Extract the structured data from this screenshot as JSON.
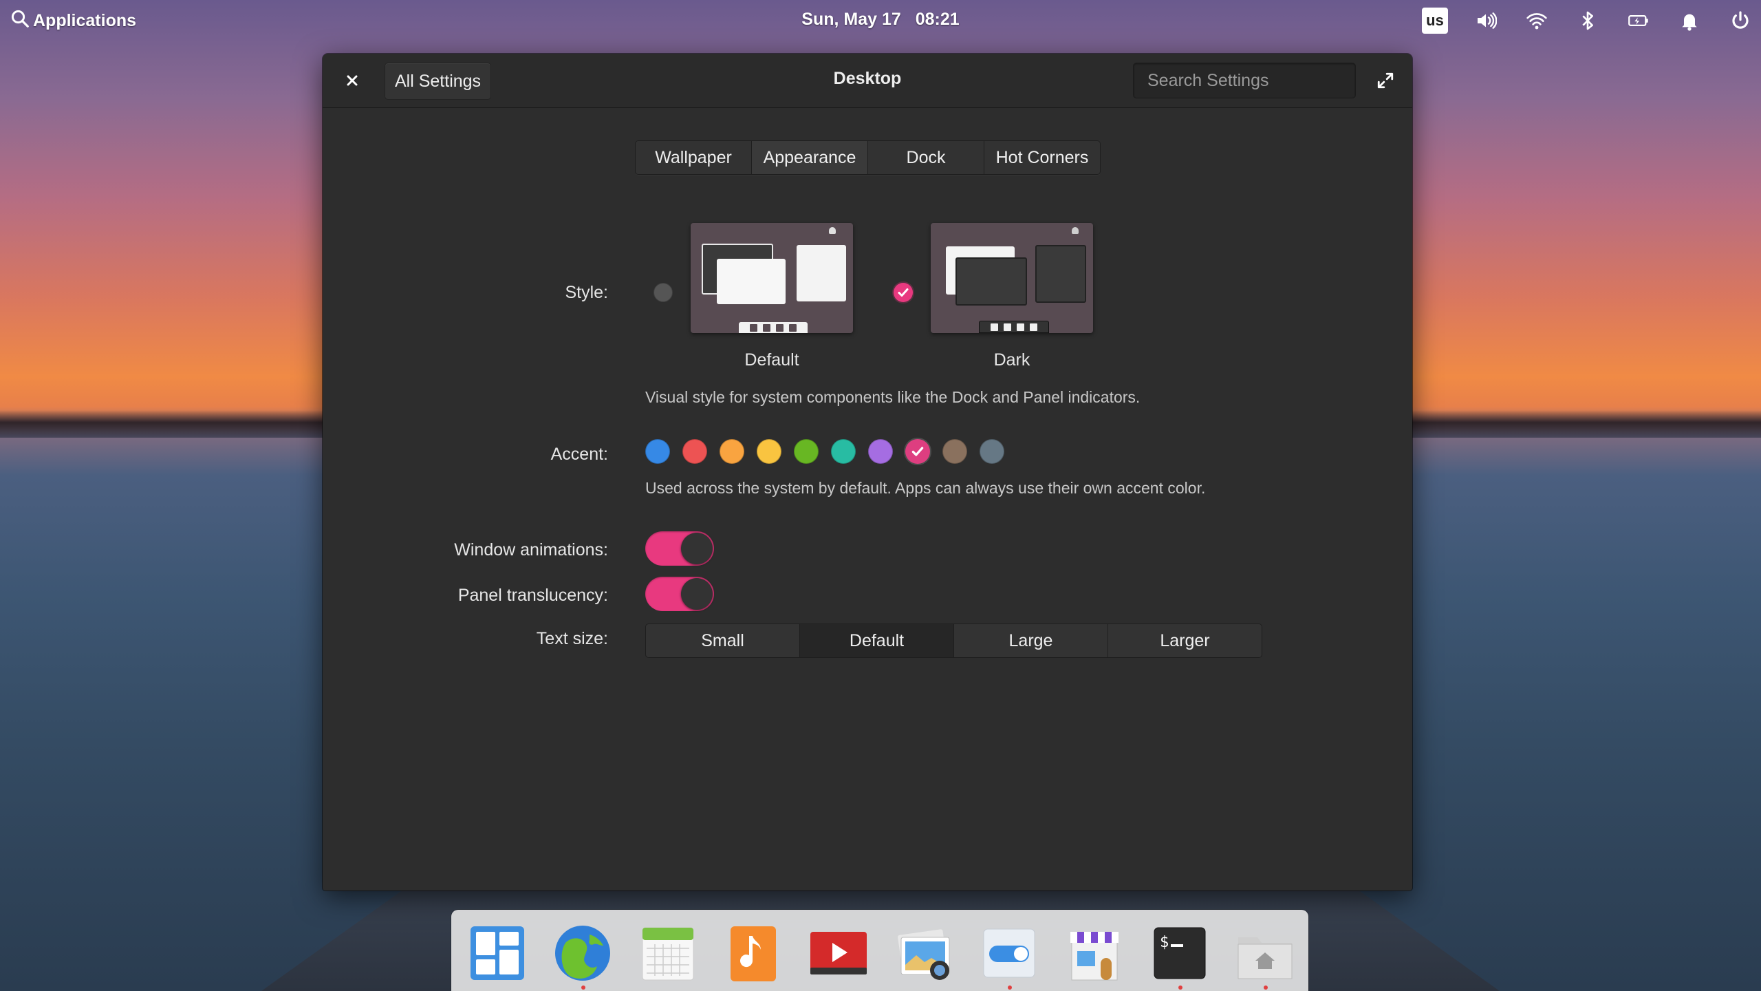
{
  "top_panel": {
    "applications_label": "Applications",
    "date": "Sun, May 17",
    "time": "08:21",
    "keyboard_layout": "us",
    "indicators": [
      "keyboard-icon",
      "volume-icon",
      "wifi-icon",
      "bluetooth-icon",
      "battery-icon",
      "notifications-icon",
      "power-icon"
    ]
  },
  "window": {
    "back_label": "All Settings",
    "title": "Desktop",
    "search_placeholder": "Search Settings",
    "tabs": [
      {
        "label": "Wallpaper",
        "active": false
      },
      {
        "label": "Appearance",
        "active": true
      },
      {
        "label": "Dock",
        "active": false
      },
      {
        "label": "Hot Corners",
        "active": false
      }
    ],
    "style": {
      "label": "Style:",
      "options": [
        {
          "label": "Default",
          "selected": false
        },
        {
          "label": "Dark",
          "selected": true
        }
      ],
      "hint": "Visual style for system components like the Dock and Panel indicators."
    },
    "accent": {
      "label": "Accent:",
      "colors": [
        "#3689e6",
        "#ed5353",
        "#f9a440",
        "#f9c440",
        "#68b723",
        "#28bca3",
        "#a56de2",
        "#de3e80",
        "#8a715e",
        "#667885"
      ],
      "selected_index": 7,
      "hint": "Used across the system by default. Apps can always use their own accent color."
    },
    "window_animations": {
      "label": "Window animations:",
      "on": true
    },
    "panel_translucency": {
      "label": "Panel translucency:",
      "on": true
    },
    "text_size": {
      "label": "Text size:",
      "options": [
        "Small",
        "Default",
        "Large",
        "Larger"
      ],
      "selected_index": 1
    }
  },
  "dock": {
    "apps": [
      "multitasking-view",
      "web-browser",
      "calendar",
      "music",
      "videos",
      "photos",
      "system-settings",
      "appcenter",
      "terminal",
      "files"
    ],
    "accent_color": "#e8397f"
  }
}
